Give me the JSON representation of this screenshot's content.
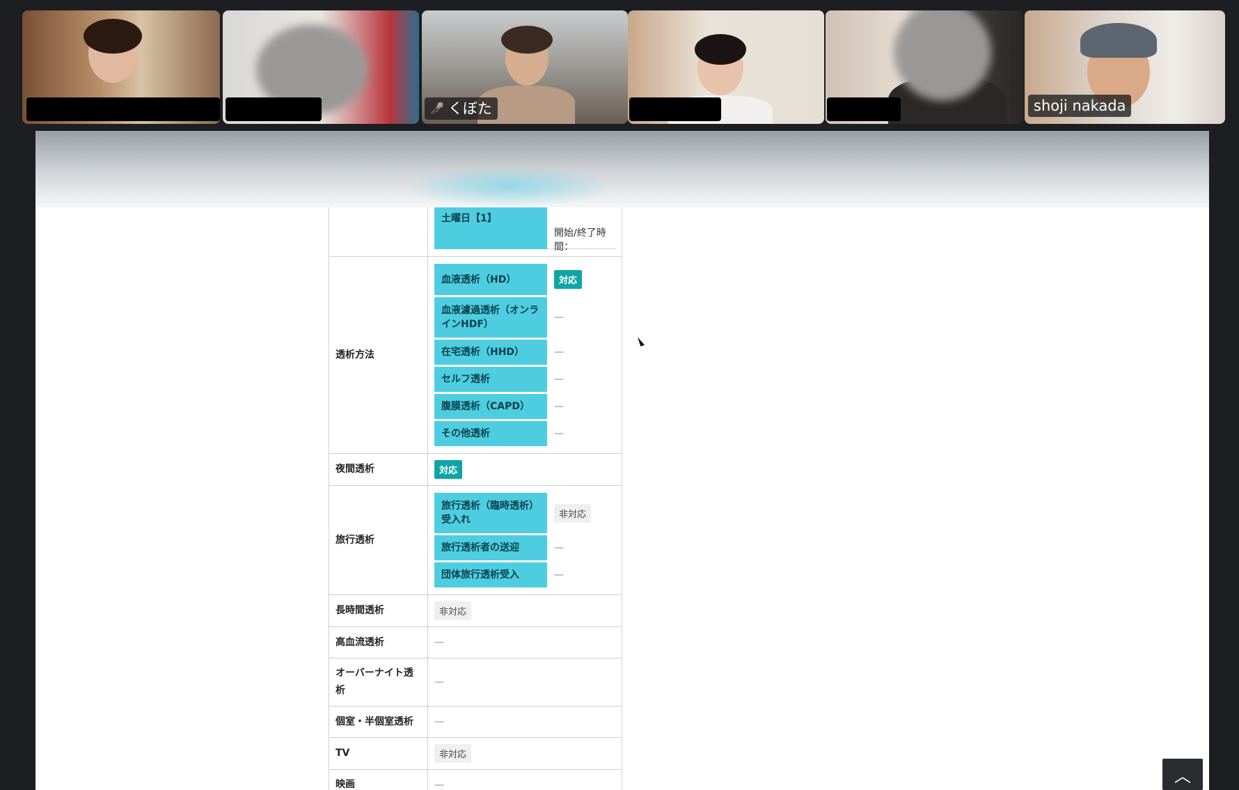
{
  "participants": [
    {
      "name": "",
      "muted": false
    },
    {
      "name": "",
      "muted": false
    },
    {
      "name": "くぼた",
      "muted": true
    },
    {
      "name": "",
      "muted": false
    },
    {
      "name": "",
      "muted": false
    },
    {
      "name": "shoji nakada",
      "muted": false,
      "active": true
    }
  ],
  "table": {
    "saturday": {
      "label": "土曜日【1】",
      "value": "開始/終了時間："
    },
    "dialysis_method": {
      "header": "透析方法",
      "items": [
        {
          "label": "血液透析（HD）",
          "value": "対応"
        },
        {
          "label": "血液濾過透析（オンラインHDF）",
          "value": "—"
        },
        {
          "label": "在宅透析（HHD）",
          "value": "—"
        },
        {
          "label": "セルフ透析",
          "value": "—"
        },
        {
          "label": "腹膜透析（CAPD）",
          "value": "—"
        },
        {
          "label": "その他透析",
          "value": "—"
        }
      ]
    },
    "night": {
      "header": "夜間透析",
      "value": "対応"
    },
    "travel": {
      "header": "旅行透析",
      "items": [
        {
          "label": "旅行透析（臨時透析）受入れ",
          "value": "非対応"
        },
        {
          "label": "旅行透析者の送迎",
          "value": "—"
        },
        {
          "label": "団体旅行透析受入",
          "value": "—"
        }
      ]
    },
    "long_time": {
      "header": "長時間透析",
      "value": "非対応"
    },
    "high_flow": {
      "header": "高血流透析",
      "value": "—"
    },
    "overnight": {
      "header": "オーバーナイト透析",
      "value": "—"
    },
    "private_room": {
      "header": "個室・半個室透析",
      "value": "—"
    },
    "tv": {
      "header": "TV",
      "value": "非対応"
    },
    "movie": {
      "header": "映画",
      "value": "—"
    }
  },
  "scroll_top_icon": "chevron-up-icon"
}
